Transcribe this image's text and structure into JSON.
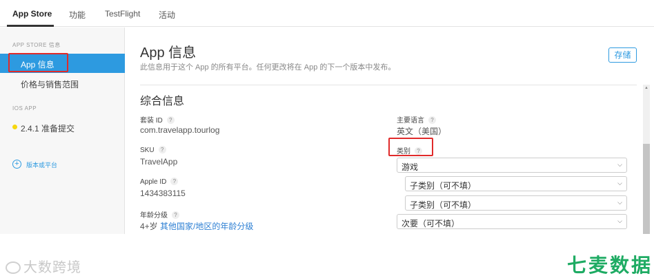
{
  "topnav": {
    "tabs": [
      {
        "label": "App Store"
      },
      {
        "label": "功能"
      },
      {
        "label": "TestFlight"
      },
      {
        "label": "活动"
      }
    ]
  },
  "sidebar": {
    "section_store": "APP STORE 信息",
    "item_app_info": "App 信息",
    "item_pricing": "价格与销售范围",
    "section_ios": "IOS APP",
    "item_version": "2.4.1 准备提交",
    "add_platform": "版本或平台"
  },
  "main": {
    "title": "App 信息",
    "subtitle": "此信息用于这个 App 的所有平台。任何更改将在 App 的下一个版本中发布。",
    "save_label": "存储",
    "section_title": "综合信息",
    "bundle_id_label": "套装 ID",
    "bundle_id_value": "com.travelapp.tourlog",
    "sku_label": "SKU",
    "sku_value": "TravelApp",
    "apple_id_label": "Apple ID",
    "apple_id_value": "1434383115",
    "age_label": "年龄分级",
    "age_value": "4+岁",
    "age_link": "其他国家/地区的年龄分级",
    "primary_lang_label": "主要语言",
    "primary_lang_value": "英文（美国）",
    "category_label": "类别",
    "primary_category": "游戏",
    "subcategory_1": "子类别（可不填）",
    "subcategory_2": "子类别（可不填）",
    "secondary_category": "次要（可不填）",
    "help_glyph": "?"
  },
  "footer": {
    "left_watermark": "大数跨境",
    "right_watermark": "七麦数据"
  },
  "colors": {
    "accent": "#2d9ae0",
    "highlight_box": "#e02a2a",
    "status_dot": "#f6d70e",
    "brand_green": "#1eab63"
  }
}
